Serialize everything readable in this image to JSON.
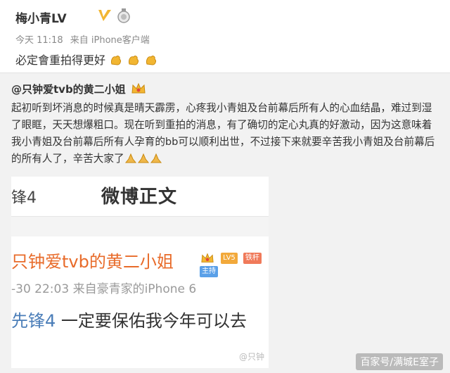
{
  "post": {
    "username": "梅小青LV",
    "time": "今天 11:18",
    "source": "来自 iPhone客户端",
    "text": "必定會重拍得更好"
  },
  "repost": {
    "author": "@只钟爱tvb的黄二小姐",
    "body": "起初听到坏消息的时候真是晴天霹雳，心疼我小青姐及台前幕后所有人的心血结晶，难过到湿了眼眶，天天想爆粗口。现在听到重拍的消息，有了确切的定心丸真的好激动，因为这意味着我小青姐及台前幕后所有人孕育的bb可以顺利出世，不过接下来就要辛苦我小青姐及台前幕后的所有人了，辛苦大家了"
  },
  "embed": {
    "tab_left": "锋4",
    "title": "微博正文",
    "name": "只钟爱tvb的黄二小姐",
    "badges": [
      "LV5",
      "铁杆",
      "主持"
    ],
    "meta": "-30 22:03  来自豪青家的iPhone 6",
    "topic": "先锋4",
    "line": " 一定要保佑我今年可以去",
    "foot": "@只钟"
  },
  "watermark": "百家号/满城E室子",
  "colors": {
    "accent_orange": "#e86b2a",
    "badge_gold": "#f2b632",
    "topic_blue": "#4a7db8"
  }
}
